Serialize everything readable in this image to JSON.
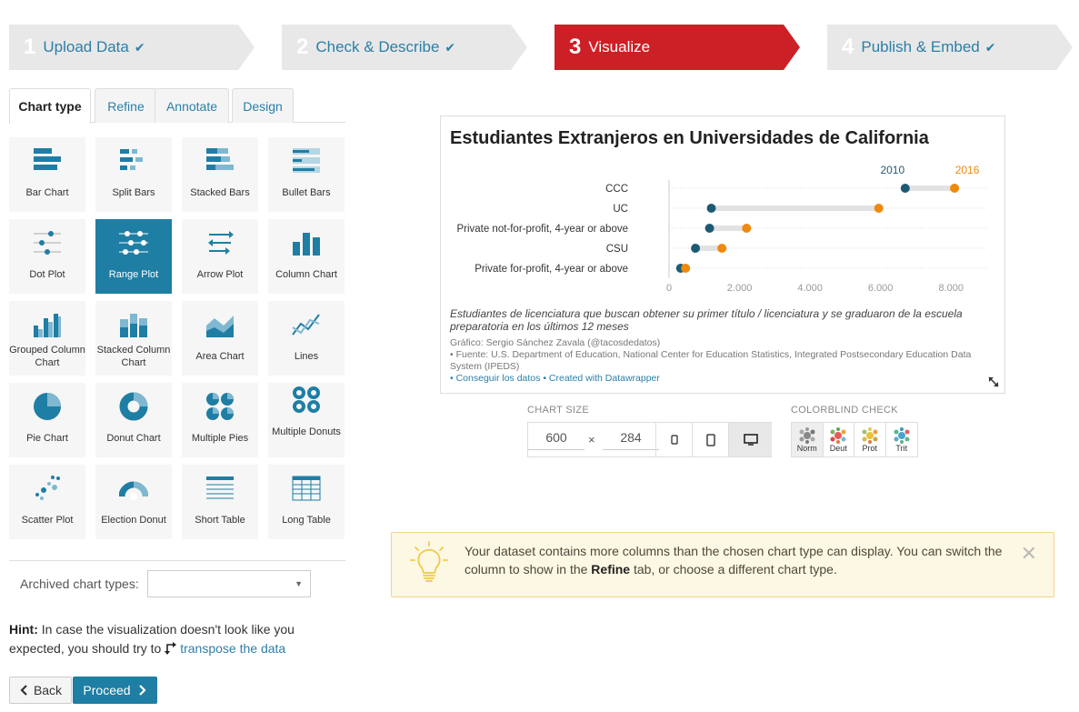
{
  "steps": [
    {
      "num": "1",
      "label": "Upload Data",
      "check": "✔"
    },
    {
      "num": "2",
      "label": "Check & Describe",
      "check": "✔"
    },
    {
      "num": "3",
      "label": "Visualize",
      "check": ""
    },
    {
      "num": "4",
      "label": "Publish & Embed",
      "check": "✔"
    }
  ],
  "tabs": [
    "Chart type",
    "Refine",
    "Annotate",
    "Design"
  ],
  "chart_types": [
    {
      "label": "Bar Chart",
      "icon": "bar-chart-icon"
    },
    {
      "label": "Split Bars",
      "icon": "split-bars-icon"
    },
    {
      "label": "Stacked Bars",
      "icon": "stacked-bars-icon"
    },
    {
      "label": "Bullet Bars",
      "icon": "bullet-bars-icon"
    },
    {
      "label": "Dot Plot",
      "icon": "dot-plot-icon"
    },
    {
      "label": "Range Plot",
      "icon": "range-plot-icon"
    },
    {
      "label": "Arrow Plot",
      "icon": "arrow-plot-icon"
    },
    {
      "label": "Column Chart",
      "icon": "column-chart-icon"
    },
    {
      "label": "Grouped Column Chart",
      "icon": "grouped-column-icon"
    },
    {
      "label": "Stacked Column Chart",
      "icon": "stacked-column-icon"
    },
    {
      "label": "Area Chart",
      "icon": "area-chart-icon"
    },
    {
      "label": "Lines",
      "icon": "lines-icon"
    },
    {
      "label": "Pie Chart",
      "icon": "pie-chart-icon"
    },
    {
      "label": "Donut Chart",
      "icon": "donut-chart-icon"
    },
    {
      "label": "Multiple Pies",
      "icon": "multiple-pies-icon"
    },
    {
      "label": "Multiple Donuts",
      "icon": "multiple-donuts-icon"
    },
    {
      "label": "Scatter Plot",
      "icon": "scatter-plot-icon"
    },
    {
      "label": "Election Donut",
      "icon": "election-donut-icon"
    },
    {
      "label": "Short Table",
      "icon": "short-table-icon"
    },
    {
      "label": "Long Table",
      "icon": "long-table-icon"
    }
  ],
  "archived": {
    "label": "Archived chart types:",
    "value": "",
    "arrow": "▼"
  },
  "hint": {
    "bold": "Hint:",
    "text": " In case the visualization doesn't look like you expected, you should try to ",
    "link": "transpose the data"
  },
  "buttons": {
    "back": "Back",
    "proceed": "Proceed"
  },
  "chart_size": {
    "label": "CHART SIZE",
    "width": "600",
    "height": "284",
    "times": "×"
  },
  "colorblind": {
    "label": "COLORBLIND CHECK",
    "modes": [
      "Norm",
      "Deut",
      "Prot",
      "Trit"
    ]
  },
  "alert": {
    "text1": "Your dataset contains more columns than the chosen chart type can display. You can switch the column to show in the ",
    "bold": "Refine",
    "text2": " tab, or choose a different chart type.",
    "close": "✕"
  },
  "chart_data": {
    "type": "range",
    "title": "Estudiantes Extranjeros en Universidades de California",
    "series": [
      {
        "name": "2010",
        "color": "#1d5b74"
      },
      {
        "name": "2016",
        "color": "#f0890c"
      }
    ],
    "categories": [
      "CCC",
      "UC",
      "Private not-for-profit, 4-year or above",
      "CSU",
      "Private for-profit, 4-year or above"
    ],
    "values_2010": [
      6700,
      1200,
      1150,
      750,
      330
    ],
    "values_2016": [
      8100,
      5950,
      2200,
      1500,
      470
    ],
    "xlim": [
      0,
      9000
    ],
    "xticks": [
      0,
      2000,
      4000,
      6000,
      8000
    ],
    "xtick_labels": [
      "0",
      "2.000",
      "4.000",
      "6.000",
      "8.000"
    ],
    "notes": "Estudiantes de licenciatura que buscan obtener su primer título / licenciatura y se graduaron de la escuela preparatoria en los últimos 12 meses",
    "byline": "Gráfico: Sergio Sánchez Zavala (@tacosdedatos)",
    "source": "• Fuente: U.S. Department of Education, National Center for Education Statistics, Integrated Postsecondary Education Data System (IPEDS)",
    "links": "• Conseguir los datos • Created with Datawrapper"
  }
}
